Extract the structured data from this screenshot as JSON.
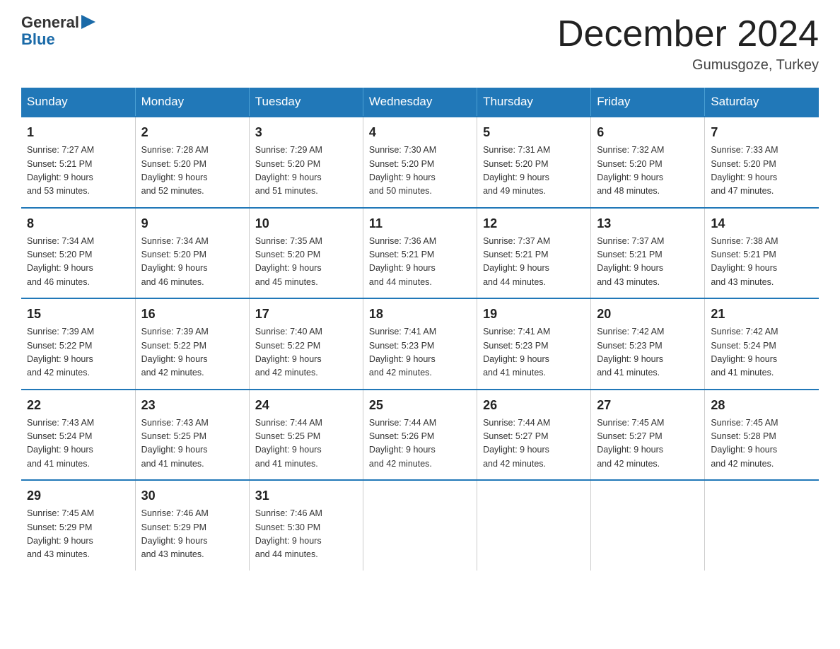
{
  "logo": {
    "general": "General",
    "blue": "Blue"
  },
  "title": {
    "month_year": "December 2024",
    "location": "Gumusgoze, Turkey"
  },
  "weekdays": [
    "Sunday",
    "Monday",
    "Tuesday",
    "Wednesday",
    "Thursday",
    "Friday",
    "Saturday"
  ],
  "weeks": [
    [
      {
        "day": "1",
        "sunrise": "7:27 AM",
        "sunset": "5:21 PM",
        "daylight": "9 hours and 53 minutes."
      },
      {
        "day": "2",
        "sunrise": "7:28 AM",
        "sunset": "5:20 PM",
        "daylight": "9 hours and 52 minutes."
      },
      {
        "day": "3",
        "sunrise": "7:29 AM",
        "sunset": "5:20 PM",
        "daylight": "9 hours and 51 minutes."
      },
      {
        "day": "4",
        "sunrise": "7:30 AM",
        "sunset": "5:20 PM",
        "daylight": "9 hours and 50 minutes."
      },
      {
        "day": "5",
        "sunrise": "7:31 AM",
        "sunset": "5:20 PM",
        "daylight": "9 hours and 49 minutes."
      },
      {
        "day": "6",
        "sunrise": "7:32 AM",
        "sunset": "5:20 PM",
        "daylight": "9 hours and 48 minutes."
      },
      {
        "day": "7",
        "sunrise": "7:33 AM",
        "sunset": "5:20 PM",
        "daylight": "9 hours and 47 minutes."
      }
    ],
    [
      {
        "day": "8",
        "sunrise": "7:34 AM",
        "sunset": "5:20 PM",
        "daylight": "9 hours and 46 minutes."
      },
      {
        "day": "9",
        "sunrise": "7:34 AM",
        "sunset": "5:20 PM",
        "daylight": "9 hours and 46 minutes."
      },
      {
        "day": "10",
        "sunrise": "7:35 AM",
        "sunset": "5:20 PM",
        "daylight": "9 hours and 45 minutes."
      },
      {
        "day": "11",
        "sunrise": "7:36 AM",
        "sunset": "5:21 PM",
        "daylight": "9 hours and 44 minutes."
      },
      {
        "day": "12",
        "sunrise": "7:37 AM",
        "sunset": "5:21 PM",
        "daylight": "9 hours and 44 minutes."
      },
      {
        "day": "13",
        "sunrise": "7:37 AM",
        "sunset": "5:21 PM",
        "daylight": "9 hours and 43 minutes."
      },
      {
        "day": "14",
        "sunrise": "7:38 AM",
        "sunset": "5:21 PM",
        "daylight": "9 hours and 43 minutes."
      }
    ],
    [
      {
        "day": "15",
        "sunrise": "7:39 AM",
        "sunset": "5:22 PM",
        "daylight": "9 hours and 42 minutes."
      },
      {
        "day": "16",
        "sunrise": "7:39 AM",
        "sunset": "5:22 PM",
        "daylight": "9 hours and 42 minutes."
      },
      {
        "day": "17",
        "sunrise": "7:40 AM",
        "sunset": "5:22 PM",
        "daylight": "9 hours and 42 minutes."
      },
      {
        "day": "18",
        "sunrise": "7:41 AM",
        "sunset": "5:23 PM",
        "daylight": "9 hours and 42 minutes."
      },
      {
        "day": "19",
        "sunrise": "7:41 AM",
        "sunset": "5:23 PM",
        "daylight": "9 hours and 41 minutes."
      },
      {
        "day": "20",
        "sunrise": "7:42 AM",
        "sunset": "5:23 PM",
        "daylight": "9 hours and 41 minutes."
      },
      {
        "day": "21",
        "sunrise": "7:42 AM",
        "sunset": "5:24 PM",
        "daylight": "9 hours and 41 minutes."
      }
    ],
    [
      {
        "day": "22",
        "sunrise": "7:43 AM",
        "sunset": "5:24 PM",
        "daylight": "9 hours and 41 minutes."
      },
      {
        "day": "23",
        "sunrise": "7:43 AM",
        "sunset": "5:25 PM",
        "daylight": "9 hours and 41 minutes."
      },
      {
        "day": "24",
        "sunrise": "7:44 AM",
        "sunset": "5:25 PM",
        "daylight": "9 hours and 41 minutes."
      },
      {
        "day": "25",
        "sunrise": "7:44 AM",
        "sunset": "5:26 PM",
        "daylight": "9 hours and 42 minutes."
      },
      {
        "day": "26",
        "sunrise": "7:44 AM",
        "sunset": "5:27 PM",
        "daylight": "9 hours and 42 minutes."
      },
      {
        "day": "27",
        "sunrise": "7:45 AM",
        "sunset": "5:27 PM",
        "daylight": "9 hours and 42 minutes."
      },
      {
        "day": "28",
        "sunrise": "7:45 AM",
        "sunset": "5:28 PM",
        "daylight": "9 hours and 42 minutes."
      }
    ],
    [
      {
        "day": "29",
        "sunrise": "7:45 AM",
        "sunset": "5:29 PM",
        "daylight": "9 hours and 43 minutes."
      },
      {
        "day": "30",
        "sunrise": "7:46 AM",
        "sunset": "5:29 PM",
        "daylight": "9 hours and 43 minutes."
      },
      {
        "day": "31",
        "sunrise": "7:46 AM",
        "sunset": "5:30 PM",
        "daylight": "9 hours and 44 minutes."
      },
      null,
      null,
      null,
      null
    ]
  ],
  "labels": {
    "sunrise": "Sunrise:",
    "sunset": "Sunset:",
    "daylight": "Daylight:"
  }
}
